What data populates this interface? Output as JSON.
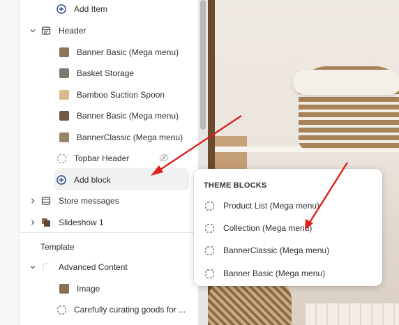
{
  "sidebar": {
    "add_item_label": "Add Item",
    "header": {
      "label": "Header",
      "icon": "header-section-icon"
    },
    "blocks": [
      {
        "label": "Banner Basic (Mega menu)",
        "thumb": "#8c7659"
      },
      {
        "label": "Basket Storage",
        "thumb": "#7a7a70"
      },
      {
        "label": "Bamboo Suction Spoon",
        "thumb": "#d8b98e"
      },
      {
        "label": "Banner Basic (Mega menu)",
        "thumb": "#6f5a45"
      },
      {
        "label": "BannerClassic (Mega menu)",
        "thumb": "#9a8467"
      }
    ],
    "topbar_header": {
      "label": "Topbar Header",
      "hidden_icon": "eye-slash-icon"
    },
    "add_block_label": "Add block",
    "store_messages": {
      "label": "Store messages"
    },
    "slideshow": {
      "label": "Slideshow 1"
    },
    "template_title": "Template",
    "advanced_content": {
      "label": "Advanced Content"
    },
    "image_block": {
      "label": "Image",
      "thumb": "#8b6f52"
    },
    "text_block": {
      "label": "Carefully curating goods for ..."
    }
  },
  "popover": {
    "title": "THEME BLOCKS",
    "items": [
      {
        "label": "Product List (Mega menu)"
      },
      {
        "label": "Collection (Mega menu)"
      },
      {
        "label": "BannerClassic (Mega menu)"
      },
      {
        "label": "Banner Basic (Mega menu)"
      }
    ]
  },
  "colors": {
    "accent": "#1f3e8f",
    "annotation_arrow": "#e0201b"
  }
}
